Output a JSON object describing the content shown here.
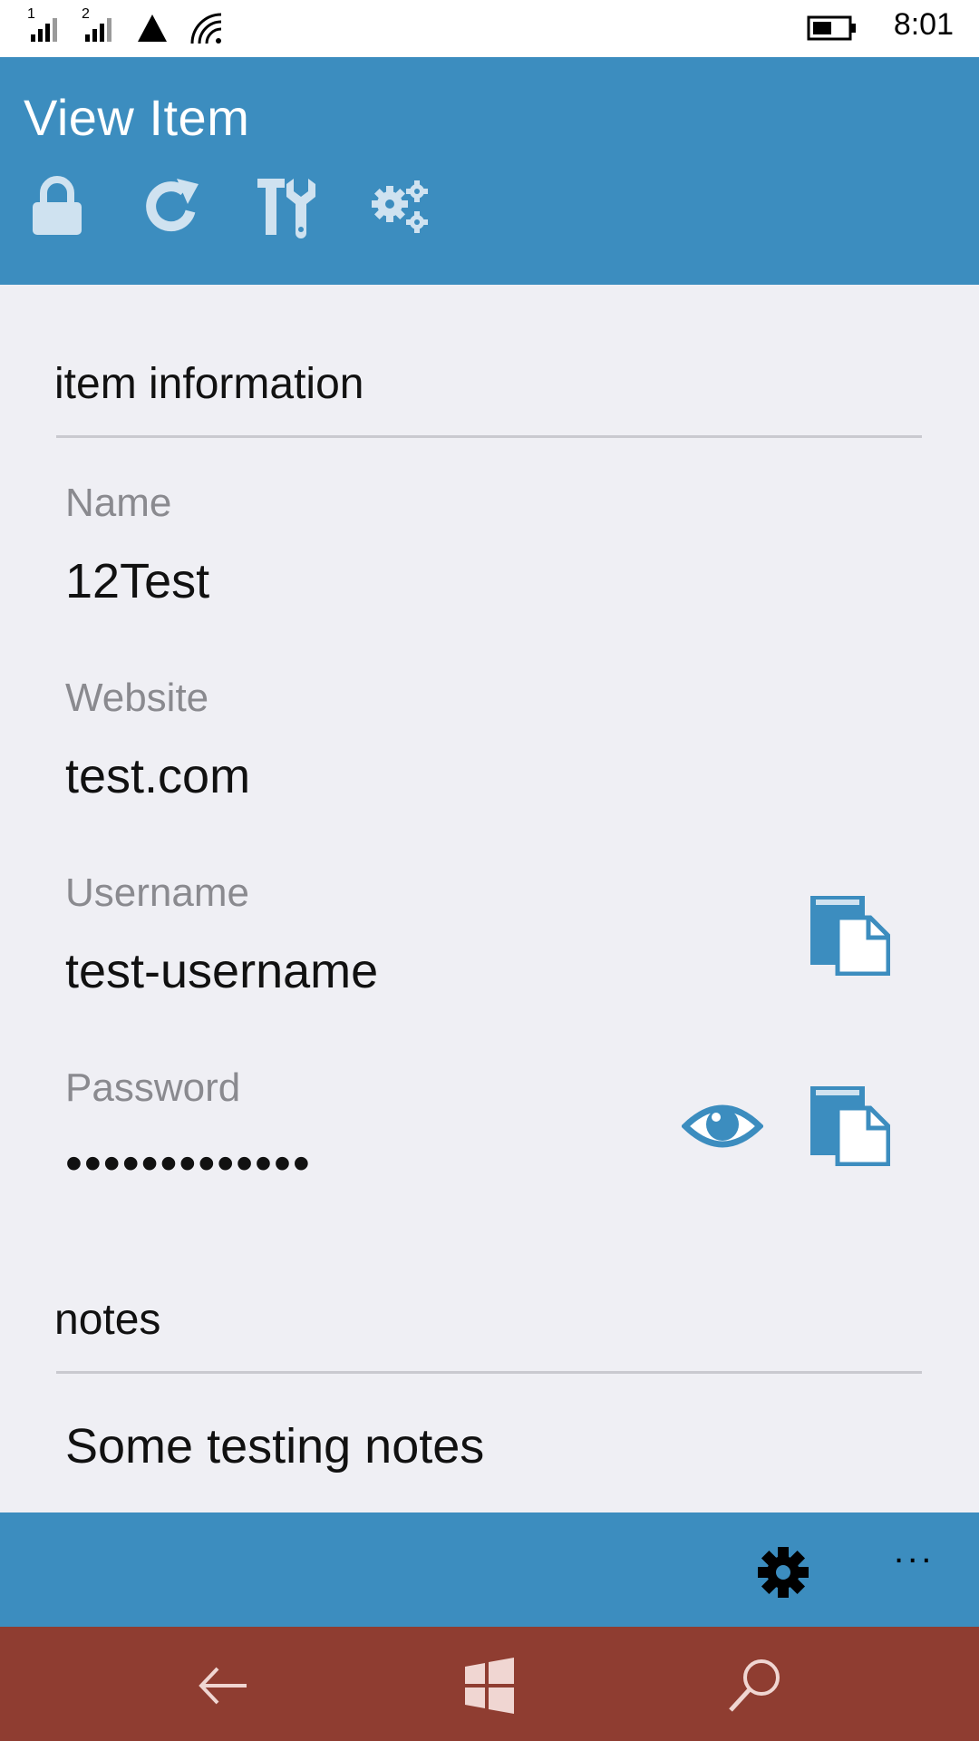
{
  "status_bar": {
    "sim1": "1",
    "sim2": "2",
    "time": "8:01",
    "icons": [
      "signal-sim1-icon",
      "signal-sim2-icon",
      "data-triangle-icon",
      "wifi-icon",
      "battery-icon"
    ]
  },
  "header": {
    "title": "View Item",
    "toolbar": [
      {
        "name": "lock-icon"
      },
      {
        "name": "refresh-icon"
      },
      {
        "name": "tools-icon"
      },
      {
        "name": "settings-gears-icon"
      }
    ]
  },
  "item_information": {
    "section_title": "item information",
    "fields": {
      "name": {
        "label": "Name",
        "value": "12Test"
      },
      "website": {
        "label": "Website",
        "value": "test.com"
      },
      "username": {
        "label": "Username",
        "value": "test-username"
      },
      "password": {
        "label": "Password",
        "value": "•••••••••••••"
      }
    }
  },
  "notes": {
    "section_title": "notes",
    "value": "Some testing notes"
  },
  "app_bar": {
    "more_label": "...",
    "icons": [
      "gear-icon"
    ]
  },
  "nav_bar": {
    "icons": [
      "back-arrow-icon",
      "windows-icon",
      "search-icon"
    ]
  },
  "colors": {
    "accent": "#3c8dbf",
    "nav_bar": "#8f3d31",
    "background": "#efeff4",
    "icon_light": "#cfe2f0"
  }
}
